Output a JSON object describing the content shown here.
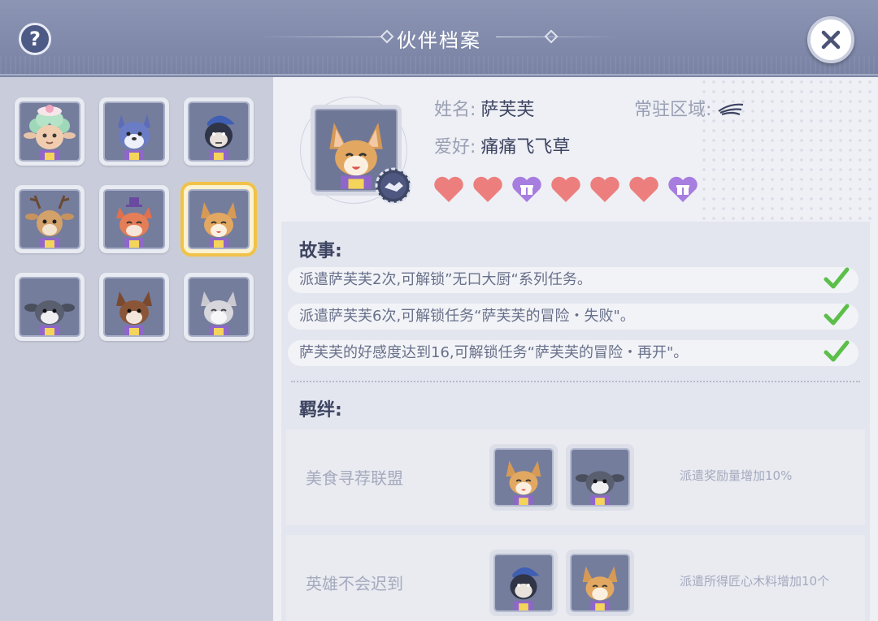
{
  "header": {
    "title": "伙伴档案",
    "help_label": "?",
    "close_label": "✕"
  },
  "roster": [
    {
      "name": "sheep-partner",
      "selected": false
    },
    {
      "name": "wolf-partner",
      "selected": false
    },
    {
      "name": "gorilla-partner",
      "selected": false
    },
    {
      "name": "deer-partner",
      "selected": false
    },
    {
      "name": "fox-partner",
      "selected": false
    },
    {
      "name": "corgi-partner",
      "selected": true
    },
    {
      "name": "husky-partner",
      "selected": false
    },
    {
      "name": "brown-dog-partner",
      "selected": false
    },
    {
      "name": "cat-partner",
      "selected": false
    }
  ],
  "profile": {
    "name_label": "姓名:",
    "name_value": "萨芙芙",
    "hobby_label": "爱好:",
    "hobby_value": "痛痛飞飞草",
    "region_label": "常驻区域:",
    "hearts": [
      "heart",
      "heart",
      "gift",
      "heart",
      "heart",
      "heart",
      "gift"
    ],
    "colors": {
      "heart": "#ec7f7e",
      "gift": "#a77de0"
    }
  },
  "story": {
    "title": "故事:",
    "tasks": [
      {
        "text": "派遣萨芙芙2次,可解锁”无口大厨“系列任务。",
        "done": true
      },
      {
        "text": "派遣萨芙芙6次,可解锁任务“萨芙芙的冒险・失败\"。",
        "done": true
      },
      {
        "text": "萨芙芙的好感度达到16,可解锁任务“萨芙芙的冒险・再开\"。",
        "done": true
      }
    ]
  },
  "bonds": {
    "title": "羁绊:",
    "items": [
      {
        "name": "美食寻荐联盟",
        "effect": "派遣奖励量增加10%",
        "members": [
          "corgi",
          "husky"
        ]
      },
      {
        "name": "英雄不会迟到",
        "effect": "派遣所得匠心木料增加10个",
        "members": [
          "gorilla",
          "corgi"
        ]
      }
    ]
  }
}
